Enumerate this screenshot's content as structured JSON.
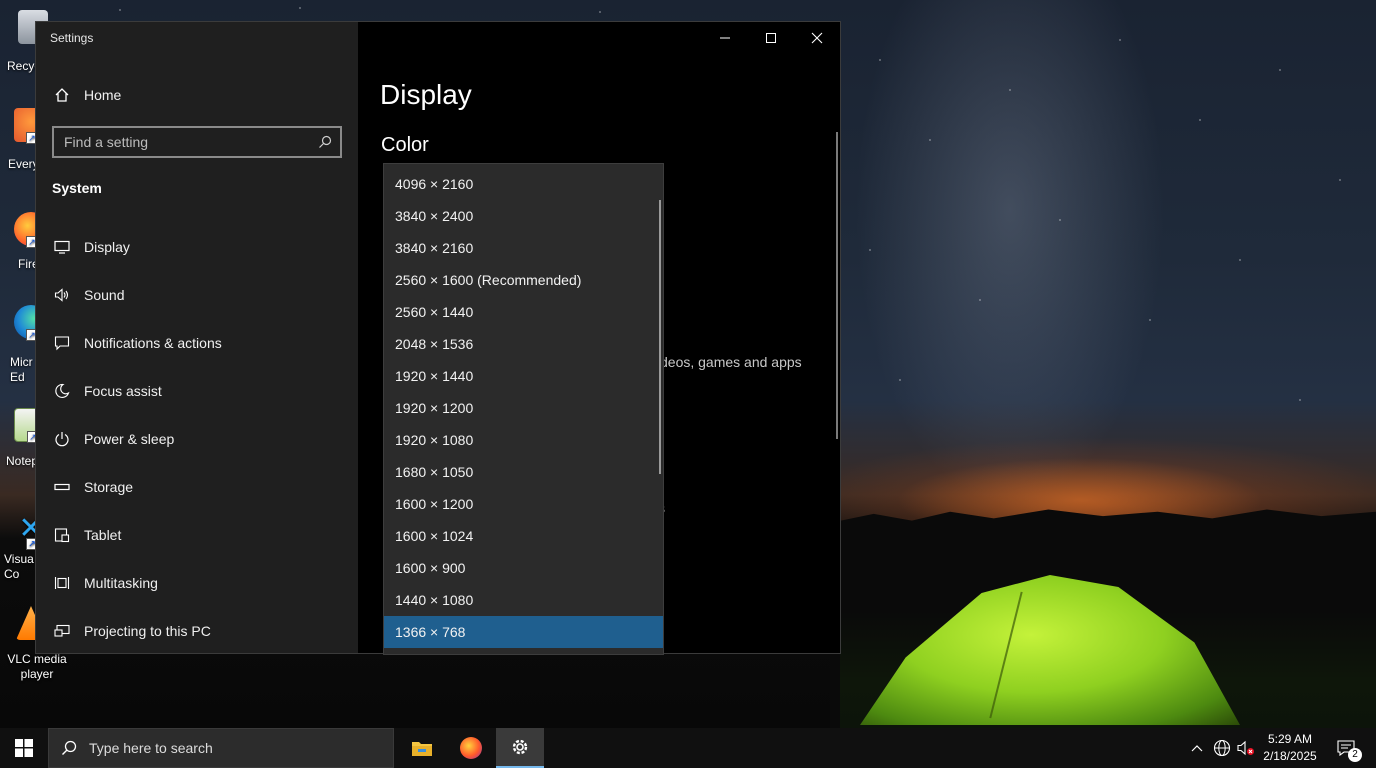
{
  "desktop": {
    "icons": [
      {
        "label": "Recyc",
        "icon": "recycle-bin-icon"
      },
      {
        "label": "Every",
        "icon": "everything-icon"
      },
      {
        "label": "Fire",
        "icon": "firefox-icon"
      },
      {
        "label": "Micr\nEd",
        "icon": "edge-icon"
      },
      {
        "label": "Notep",
        "icon": "notepad-icon"
      },
      {
        "label": "Visua\nCo",
        "icon": "vscode-icon"
      },
      {
        "label": "VLC media\nplayer",
        "icon": "vlc-icon"
      }
    ]
  },
  "window": {
    "title": "Settings",
    "controls": {
      "minimize": "minimize-icon",
      "maximize": "maximize-icon",
      "close": "close-icon"
    }
  },
  "sidebar": {
    "home_label": "Home",
    "search_placeholder": "Find a setting",
    "section_label": "System",
    "items": [
      {
        "label": "Display",
        "icon": "monitor-icon"
      },
      {
        "label": "Sound",
        "icon": "speaker-icon"
      },
      {
        "label": "Notifications & actions",
        "icon": "notification-icon"
      },
      {
        "label": "Focus assist",
        "icon": "moon-icon"
      },
      {
        "label": "Power & sleep",
        "icon": "power-icon"
      },
      {
        "label": "Storage",
        "icon": "storage-icon"
      },
      {
        "label": "Tablet",
        "icon": "tablet-icon"
      },
      {
        "label": "Multitasking",
        "icon": "multitasking-icon"
      },
      {
        "label": "Projecting to this PC",
        "icon": "projecting-icon"
      }
    ]
  },
  "content": {
    "page_title": "Display",
    "subheading": "Color",
    "partial_text_1": "deos, games and apps",
    "partial_text_2": "s"
  },
  "resolution_dropdown": {
    "options": [
      "4096 × 2160",
      "3840 × 2400",
      "3840 × 2160",
      "2560 × 1600 (Recommended)",
      "2560 × 1440",
      "2048 × 1536",
      "1920 × 1440",
      "1920 × 1200",
      "1920 × 1080",
      "1680 × 1050",
      "1600 × 1200",
      "1600 × 1024",
      "1600 × 900",
      "1440 × 1080",
      "1366 × 768"
    ],
    "selected": "1366 × 768"
  },
  "taskbar": {
    "search_placeholder": "Type here to search",
    "pinned": [
      "file-explorer-icon",
      "firefox-icon",
      "settings-gear-icon"
    ],
    "active_app": "settings-gear-icon",
    "tray": [
      "chevron-up-icon",
      "network-icon",
      "volume-muted-icon"
    ],
    "time": "5:29 AM",
    "date": "2/18/2025",
    "notification_count": "2"
  },
  "colors": {
    "sidebar_bg": "#1f1f1f",
    "content_bg": "#000000",
    "dropdown_bg": "#2b2b2b",
    "selected_bg": "#1f5f8f",
    "accent": "#76b9ed"
  }
}
